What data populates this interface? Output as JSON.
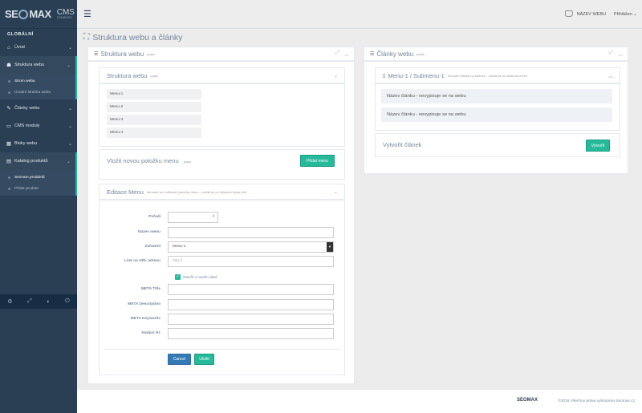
{
  "brand": {
    "logo_text_left": "SE",
    "logo_text_right": "MAX",
    "cms": "CMS",
    "edition": "STANDARD"
  },
  "sidebar": {
    "section_title": "GLOBÁLNÍ",
    "items": [
      {
        "label": "Úvod",
        "icon": "home-icon"
      },
      {
        "label": "Struktura webu",
        "icon": "sitemap-icon"
      },
      {
        "label": "Články webu",
        "icon": "edit-icon"
      },
      {
        "label": "CMS moduly",
        "icon": "desktop-icon"
      },
      {
        "label": "Bloky webu",
        "icon": "table-icon"
      },
      {
        "label": "Katalog produktů",
        "icon": "box-icon"
      }
    ],
    "sub_structure": [
      "Strom webu",
      "Úvodní stránka webu"
    ],
    "sub_catalog": [
      "Seznam produktů",
      "Přidat produkt"
    ],
    "footer_icons": [
      "settings-icon",
      "fullscreen-icon",
      "eye-slash-icon",
      "power-icon"
    ]
  },
  "topbar": {
    "site_label": "NÁZEV WEBU",
    "user_label": "Přihlášen"
  },
  "page": {
    "title": "Struktura webu a články"
  },
  "left_panel": {
    "title": "Struktura webu",
    "hint": "popis",
    "tree": {
      "title": "Struktura webu",
      "hint": "popis",
      "items": [
        "Menu-1",
        "Menu-2",
        "Menu-3",
        "Menu-4"
      ]
    },
    "new_item": {
      "title": "Vložit novou položku menu",
      "hint": "popis",
      "button": "Přidat menu"
    },
    "edit": {
      "title": "Editace Menu",
      "hint": "formulář pro editování položky menu - načítá se po stisknutí ikony edit",
      "labels": {
        "order": "Pořadí",
        "name": "Název menu",
        "assign": "Zařazení",
        "link": "Link na URL adresu",
        "meta_title": "META Title",
        "meta_desc": "META Description",
        "meta_kw": "META Keywords",
        "h1": "Nadpis H1"
      },
      "assign_value": "Menu-1",
      "link_placeholder": "http://",
      "open_new_window": "Otevřít v novém okně",
      "cancel": "Cancel",
      "save": "Uložit"
    }
  },
  "right_panel": {
    "title": "Články webu",
    "hint": "popis",
    "sub_title": "Menu-1 / Submenu-1",
    "sub_hint": "Seznam článků na stránce - načítá se po stisknutí menu",
    "articles": [
      "Název článku - nevypisuje se na webu",
      "Název článku - nevypisuje se na webu"
    ],
    "create_label": "Vytvořit článek",
    "create_button": "Vytvořit"
  },
  "footer": {
    "logo": "SEOMAX",
    "copyright": "©2016 Všechny práva vyhrazena Seomax.cz"
  }
}
